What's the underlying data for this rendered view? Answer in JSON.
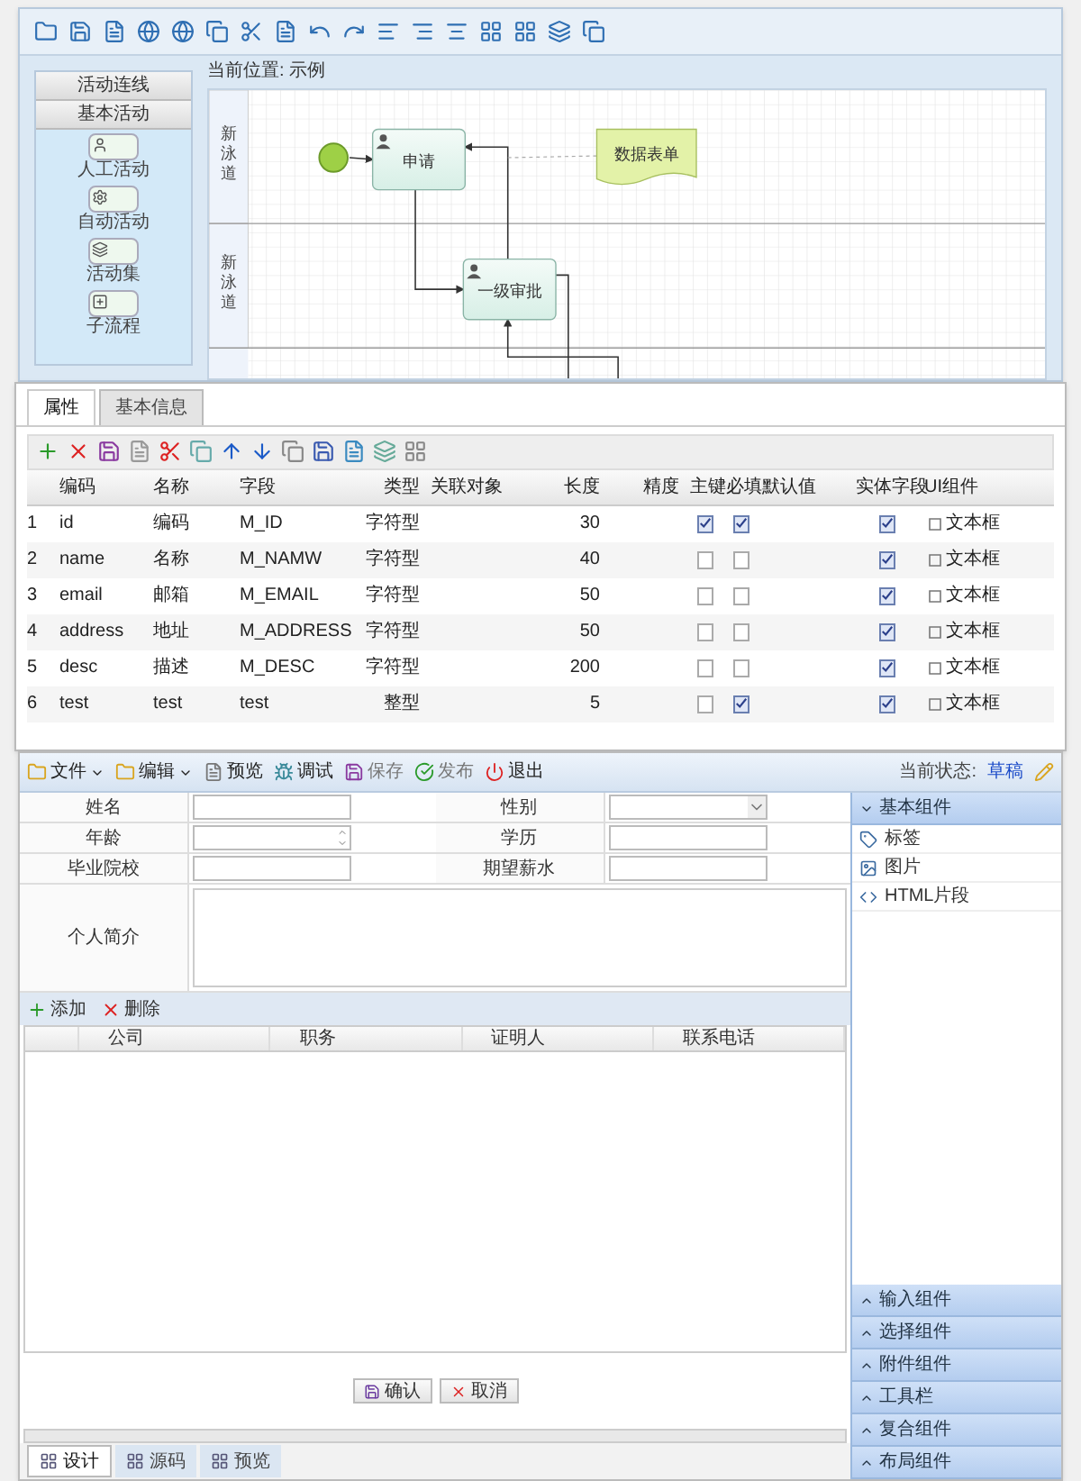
{
  "designer": {
    "palette": {
      "sections": [
        "活动连线",
        "基本活动"
      ],
      "items": [
        {
          "kind": "person",
          "label": "人工活动"
        },
        {
          "kind": "gear",
          "label": "自动活动"
        },
        {
          "kind": "set",
          "label": "活动集"
        },
        {
          "kind": "sub",
          "label": "子流程"
        }
      ]
    },
    "breadcrumb": "当前位置: 示例",
    "lanes": [
      "新泳道",
      "新泳道"
    ],
    "nodes": [
      {
        "kind": "start"
      },
      {
        "kind": "task",
        "label": "申请"
      },
      {
        "kind": "task",
        "label": "一级审批"
      },
      {
        "kind": "document",
        "label": "数据表单"
      }
    ]
  },
  "properties": {
    "tabs": [
      {
        "label": "属性",
        "selected": true
      },
      {
        "label": "基本信息",
        "selected": false
      }
    ],
    "columns": [
      "编码",
      "名称",
      "字段",
      "类型",
      "关联对象",
      "长度",
      "精度",
      "主键",
      "必填",
      "默认值",
      "实体字段",
      "UI组件"
    ],
    "rows": [
      {
        "no": "1",
        "code": "id",
        "name": "编码",
        "field": "M_ID",
        "type": "字符型",
        "length": "30",
        "primary_key": true,
        "required": true,
        "entity_field": true,
        "ui": "文本框"
      },
      {
        "no": "2",
        "code": "name",
        "name": "名称",
        "field": "M_NAMW",
        "type": "字符型",
        "length": "40",
        "primary_key": false,
        "required": false,
        "entity_field": true,
        "ui": "文本框"
      },
      {
        "no": "3",
        "code": "email",
        "name": "邮箱",
        "field": "M_EMAIL",
        "type": "字符型",
        "length": "50",
        "primary_key": false,
        "required": false,
        "entity_field": true,
        "ui": "文本框"
      },
      {
        "no": "4",
        "code": "address",
        "name": "地址",
        "field": "M_ADDRESS",
        "type": "字符型",
        "length": "50",
        "primary_key": false,
        "required": false,
        "entity_field": true,
        "ui": "文本框"
      },
      {
        "no": "5",
        "code": "desc",
        "name": "描述",
        "field": "M_DESC",
        "type": "字符型",
        "length": "200",
        "primary_key": false,
        "required": false,
        "entity_field": true,
        "ui": "文本框"
      },
      {
        "no": "6",
        "code": "test",
        "name": "test",
        "field": "test",
        "type": "整型",
        "length": "5",
        "primary_key": false,
        "required": true,
        "entity_field": true,
        "ui": "文本框"
      }
    ]
  },
  "form_designer": {
    "toolbar": [
      {
        "kind": "menu",
        "label": "文件",
        "disabled": false
      },
      {
        "kind": "menu",
        "label": "编辑",
        "disabled": false
      },
      {
        "kind": "preview",
        "label": "预览",
        "disabled": false
      },
      {
        "kind": "debug",
        "label": "调试",
        "disabled": false
      },
      {
        "kind": "save",
        "label": "保存",
        "disabled": true
      },
      {
        "kind": "publish",
        "label": "发布",
        "disabled": true
      },
      {
        "kind": "exit",
        "label": "退出",
        "disabled": false
      }
    ],
    "status_label": "当前状态:",
    "status_value": "草稿",
    "fields": [
      [
        {
          "label": "姓名",
          "kind": "text"
        },
        {
          "label": "性别",
          "kind": "select"
        }
      ],
      [
        {
          "label": "年龄",
          "kind": "spinner"
        },
        {
          "label": "学历",
          "kind": "text"
        }
      ],
      [
        {
          "label": "毕业院校",
          "kind": "text"
        },
        {
          "label": "期望薪水",
          "kind": "text"
        }
      ]
    ],
    "textarea_label": "个人简介",
    "subtable_actions": [
      {
        "kind": "add",
        "label": "添加"
      },
      {
        "kind": "delete",
        "label": "删除"
      }
    ],
    "subtable_columns": [
      "公司",
      "职务",
      "证明人",
      "联系电话"
    ],
    "buttons": [
      {
        "kind": "confirm",
        "label": "确认"
      },
      {
        "kind": "cancel",
        "label": "取消"
      }
    ],
    "view_tabs": [
      {
        "label": "设计",
        "selected": true
      },
      {
        "label": "源码",
        "selected": false
      },
      {
        "label": "预览",
        "selected": false
      }
    ],
    "component_groups": [
      {
        "label": "基本组件",
        "expanded": true,
        "items": [
          {
            "kind": "label",
            "label": "标签"
          },
          {
            "kind": "image",
            "label": "图片"
          },
          {
            "kind": "html",
            "label": "HTML片段"
          }
        ]
      },
      {
        "label": "输入组件",
        "expanded": false
      },
      {
        "label": "选择组件",
        "expanded": false
      },
      {
        "label": "附件组件",
        "expanded": false
      },
      {
        "label": "工具栏",
        "expanded": false
      },
      {
        "label": "复合组件",
        "expanded": false
      },
      {
        "label": "布局组件",
        "expanded": false
      }
    ]
  }
}
